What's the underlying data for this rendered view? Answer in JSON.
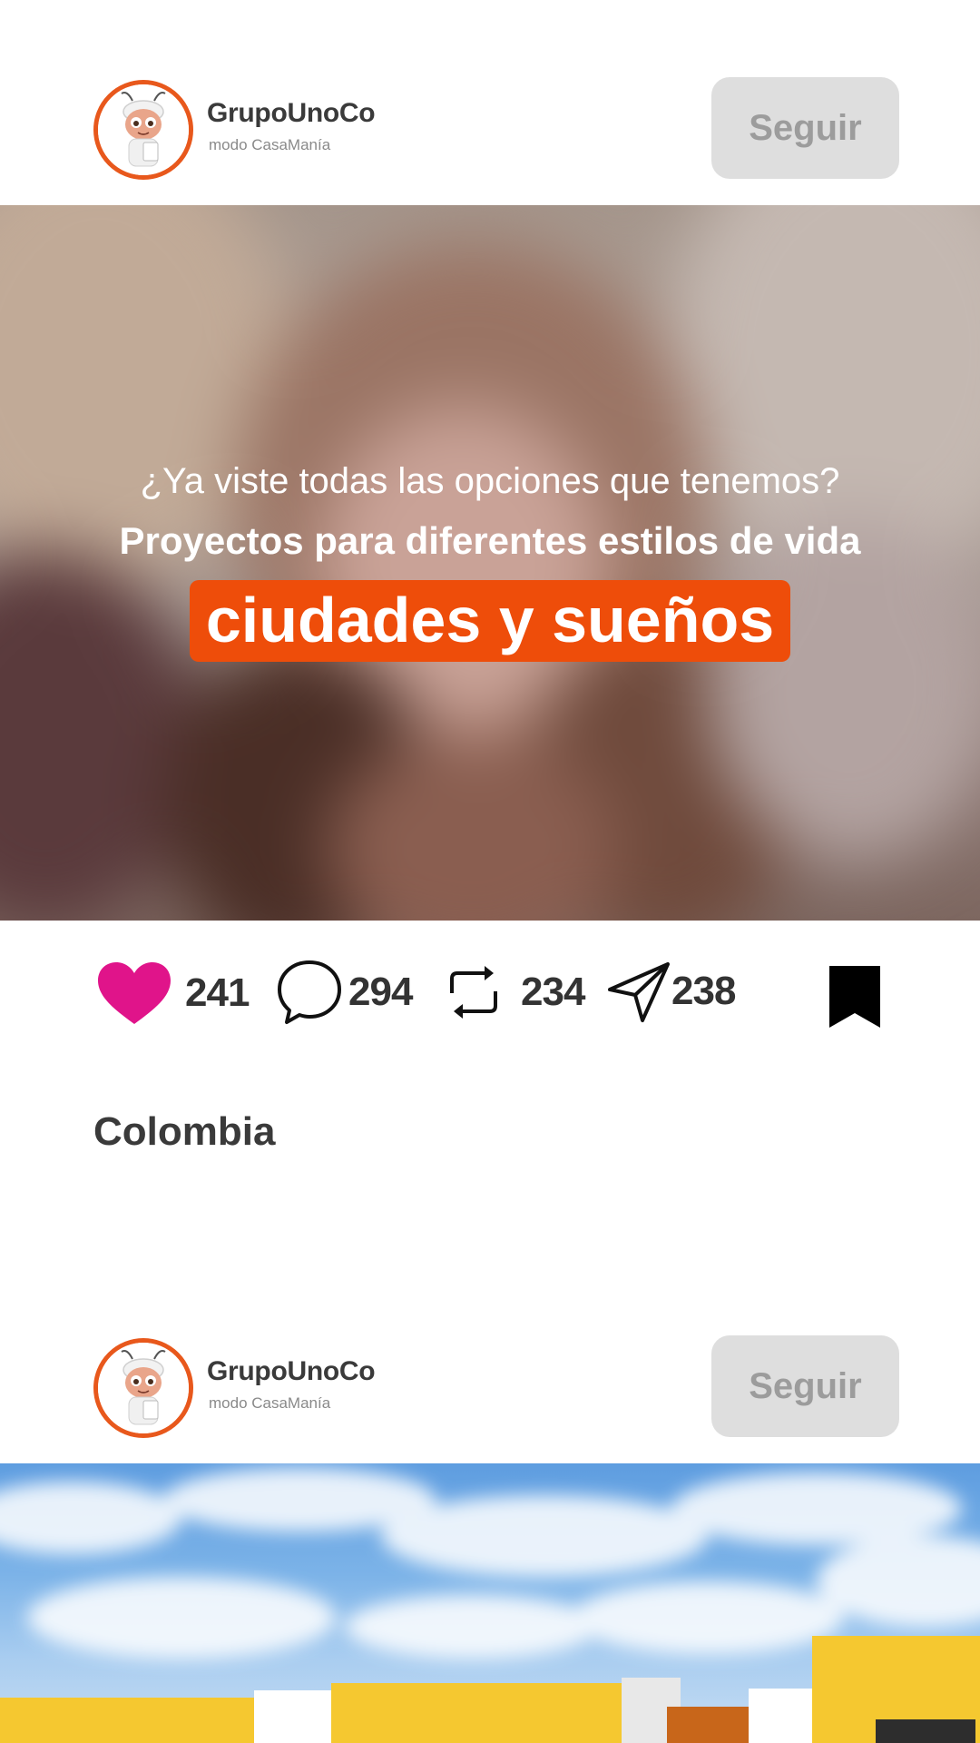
{
  "posts": [
    {
      "user": {
        "name": "GrupoUnoCo",
        "subtitle": "modo CasaManía"
      },
      "follow_label": "Seguir",
      "overlay": {
        "question": "¿Ya viste todas las opciones que tenemos?",
        "headline": "Proyectos para diferentes estilos de vida",
        "highlight": "ciudades y sueños"
      },
      "stats": {
        "likes": "241",
        "comments": "294",
        "reposts": "234",
        "shares": "238"
      },
      "location": "Colombia"
    },
    {
      "user": {
        "name": "GrupoUnoCo",
        "subtitle": "modo CasaManía"
      },
      "follow_label": "Seguir"
    }
  ],
  "icons": {
    "like": "heart-icon",
    "comment": "comment-bubble-icon",
    "repost": "repost-icon",
    "share": "paper-plane-icon",
    "save": "bookmark-icon"
  },
  "colors": {
    "brand_orange": "#ee4d0a",
    "avatar_ring": "#e8581c",
    "like_pink": "#e0148a",
    "follow_bg": "#dedede",
    "follow_text": "#9c9c9c",
    "building_yellow": "#f5c830"
  }
}
